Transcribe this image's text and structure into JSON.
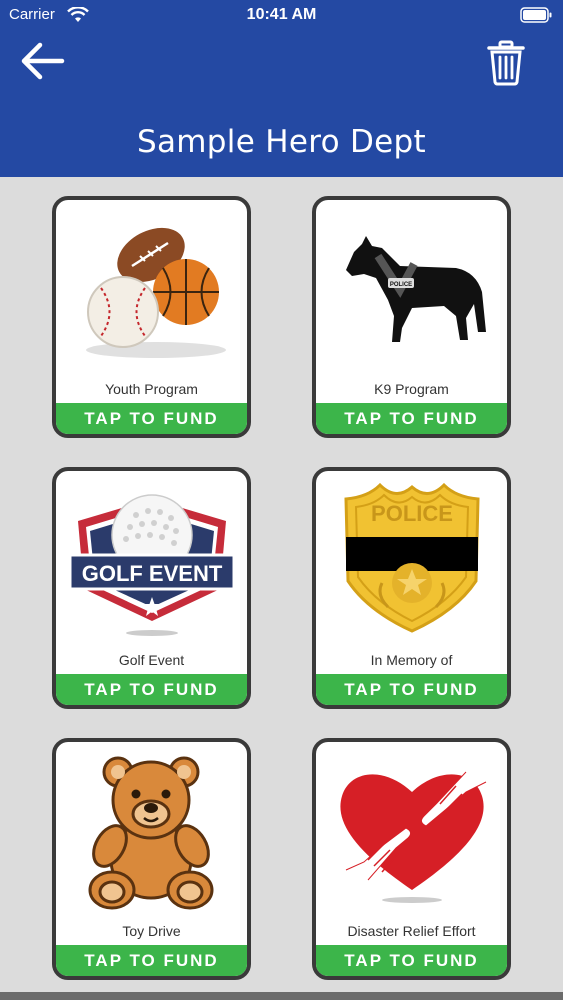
{
  "status_bar": {
    "carrier": "Carrier",
    "time": "10:41 AM"
  },
  "header": {
    "title": "Sample Hero Dept"
  },
  "colors": {
    "header_blue": "#2449a3",
    "fund_green": "#3cb54a",
    "background": "#dcdcdc"
  },
  "cards": [
    {
      "label": "Youth Program",
      "button": "TAP TO FUND",
      "icon": "sports-balls-icon"
    },
    {
      "label": "K9 Program",
      "button": "TAP TO FUND",
      "icon": "police-dog-icon"
    },
    {
      "label": "Golf Event",
      "button": "TAP TO FUND",
      "icon": "golf-event-logo"
    },
    {
      "label": "In Memory of",
      "button": "TAP TO FUND",
      "icon": "police-badge-icon"
    },
    {
      "label": "Toy Drive",
      "button": "TAP TO FUND",
      "icon": "teddy-bear-icon"
    },
    {
      "label": "Disaster Relief Effort",
      "button": "TAP TO FUND",
      "icon": "heart-hands-icon"
    }
  ],
  "art_text": {
    "police_dog_vest": "POLICE",
    "golf_banner": "GOLF EVENT",
    "badge_word": "POLICE"
  }
}
